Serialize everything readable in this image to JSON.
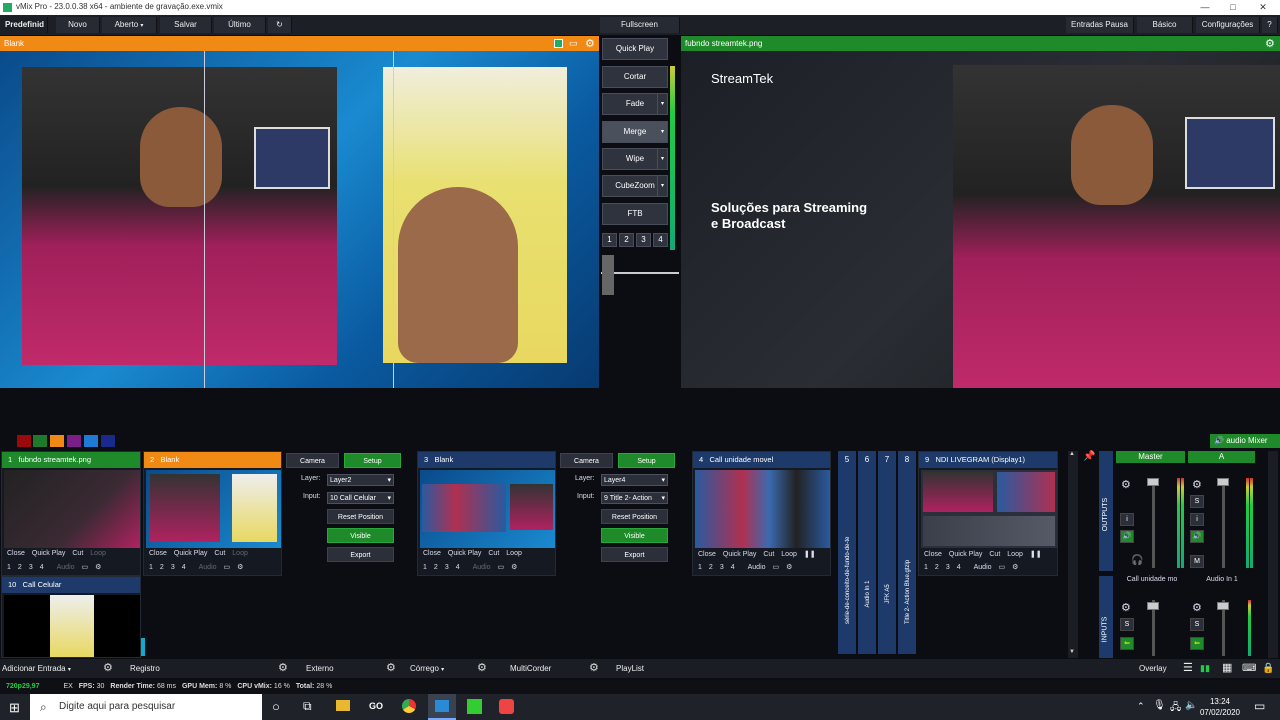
{
  "window": {
    "title": "vMix Pro - 23.0.0.38 x64 - ambiente de gravação.exe.vmix",
    "minimize": "—",
    "maximize": "□",
    "close": "✕"
  },
  "menu": {
    "preset": "Predefinid",
    "items": [
      "Novo",
      "Aberto",
      "Salvar",
      "Último"
    ],
    "fullscreen": "Fullscreen",
    "right": [
      "Entradas Pausa",
      "Básico",
      "Configurações"
    ],
    "help": "?"
  },
  "preview": {
    "title": "Blank"
  },
  "output": {
    "title": "fubndo streamtek.png",
    "logo": "StreamTek",
    "headline1": "Soluções para Streaming",
    "headline2": "e Broadcast"
  },
  "transitions": [
    "Quick Play",
    "Cortar",
    "Fade",
    "Merge",
    "Wipe",
    "CubeZoom",
    "FTB"
  ],
  "transition_numbers": [
    "1",
    "2",
    "3",
    "4"
  ],
  "tiles": [
    {
      "num": "1",
      "name": "fubndo streamtek.png",
      "controls": [
        "Close",
        "Quick Play",
        "Cut",
        "Loop"
      ],
      "nums": [
        "1",
        "2",
        "3",
        "4"
      ],
      "audio": "Audio"
    },
    {
      "num": "2",
      "name": "Blank",
      "controls": [
        "Close",
        "Quick Play",
        "Cut",
        "Loop"
      ],
      "nums": [
        "1",
        "2",
        "3",
        "4"
      ],
      "audio": "Audio"
    },
    {
      "num": "3",
      "name": "Blank",
      "controls": [
        "Close",
        "Quick Play",
        "Cut",
        "Loop"
      ],
      "nums": [
        "1",
        "2",
        "3",
        "4"
      ],
      "audio": "Audio"
    },
    {
      "num": "4",
      "name": "Call  unidade movel",
      "controls": [
        "Close",
        "Quick Play",
        "Cut",
        "Loop"
      ],
      "nums": [
        "1",
        "2",
        "3",
        "4"
      ],
      "audio": "Audio"
    },
    {
      "num": "9",
      "name": "NDI LIVEGRAM (Display1)",
      "controls": [
        "Close",
        "Quick Play",
        "Cut",
        "Loop"
      ],
      "nums": [
        "1",
        "2",
        "3",
        "4"
      ],
      "audio": "Audio"
    },
    {
      "num": "10",
      "name": "Call Celular"
    }
  ],
  "setup_panels": [
    {
      "tab1": "Camera",
      "tab2": "Setup",
      "layer_label": "Layer:",
      "layer_value": "Layer2",
      "input_label": "Input:",
      "input_value": "10 Call Celular",
      "reset": "Reset Position",
      "visible": "Visible",
      "export": "Export"
    },
    {
      "tab1": "Camera",
      "tab2": "Setup",
      "layer_label": "Layer:",
      "layer_value": "Layer4",
      "input_label": "Input:",
      "input_value": "9 Title 2- Action",
      "reset": "Reset Position",
      "visible": "Visible",
      "export": "Export"
    }
  ],
  "vertical_tiles": [
    {
      "num": "5",
      "label": "série-de-conceito-de-fundo-de-te"
    },
    {
      "num": "6",
      "label": "Audio In 1"
    },
    {
      "num": "7",
      "label": "JFK A5"
    },
    {
      "num": "8",
      "label": "Title 2- Action Blue.gtzip"
    }
  ],
  "audio_mixer": {
    "title": "audio Mixer",
    "outputs_label": "OUTPUTS",
    "inputs_label": "INPUTS",
    "master": "Master",
    "bus_a": "A",
    "input1": "Call  unidade mo",
    "input2": "Audio In 1",
    "btn_i": "i",
    "btn_s": "S",
    "btn_m": "M"
  },
  "colors": {
    "orange": "#f08a14",
    "green": "#1e8a2a",
    "blue": "#1d3a6a"
  },
  "color_swatches": [
    "#9b0a0a",
    "#1e7a2a",
    "#f08a14",
    "#7a1f8a",
    "#1f7ad6",
    "#1a2a8a"
  ],
  "bottom": {
    "add_input": "Adicionar Entrada",
    "registro": "Registro",
    "externo": "Externo",
    "corrego": "Córrego",
    "multicorder": "MultiCorder",
    "playlist": "PlayList",
    "overlay": "Overlay"
  },
  "status": {
    "format": "720p29,97",
    "ex": "EX",
    "fps_label": "FPS:",
    "fps": "30",
    "render_label": "Render Time:",
    "render": "68 ms",
    "gpu_label": "GPU Mem:",
    "gpu": "8 %",
    "cpu_label": "CPU vMix:",
    "cpu": "16 %",
    "total_label": "Total:",
    "total": "28 %"
  },
  "taskbar": {
    "search": "Digite aqui para pesquisar",
    "go": "GO",
    "time": "13:24",
    "date": "07/02/2020"
  }
}
